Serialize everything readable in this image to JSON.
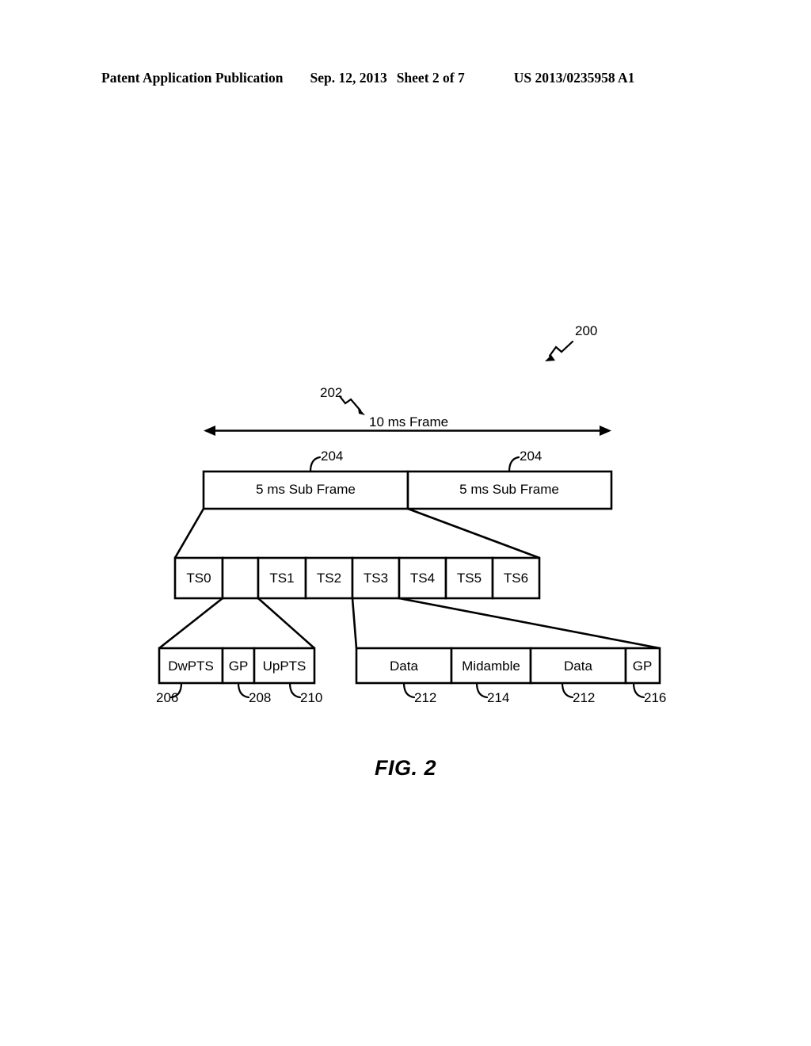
{
  "header": {
    "publication": "Patent Application Publication",
    "date": "Sep. 12, 2013",
    "sheet": "Sheet 2 of 7",
    "patent_number": "US 2013/0235958 A1"
  },
  "figure": {
    "caption": "FIG. 2",
    "diagram_ref": "200",
    "frame_arrow_label": "10 ms Frame",
    "frame_arrow_ref": "202",
    "subframes": [
      {
        "label": "5 ms Sub Frame",
        "ref": "204"
      },
      {
        "label": "5 ms Sub Frame",
        "ref": "204"
      }
    ],
    "timeslots": [
      {
        "label": "TS0"
      },
      {
        "label": ""
      },
      {
        "label": "TS1"
      },
      {
        "label": "TS2"
      },
      {
        "label": "TS3"
      },
      {
        "label": "TS4"
      },
      {
        "label": "TS5"
      },
      {
        "label": "TS6"
      }
    ],
    "special_slot_fields": [
      {
        "label": "DwPTS",
        "ref": "206"
      },
      {
        "label": "GP",
        "ref": "208"
      },
      {
        "label": "UpPTS",
        "ref": "210"
      }
    ],
    "traffic_slot_fields": [
      {
        "label": "Data",
        "ref": "212"
      },
      {
        "label": "Midamble",
        "ref": "214"
      },
      {
        "label": "Data",
        "ref": "212"
      },
      {
        "label": "GP",
        "ref": "216"
      }
    ]
  },
  "colors": {
    "ink": "#000000",
    "paper": "#ffffff"
  }
}
